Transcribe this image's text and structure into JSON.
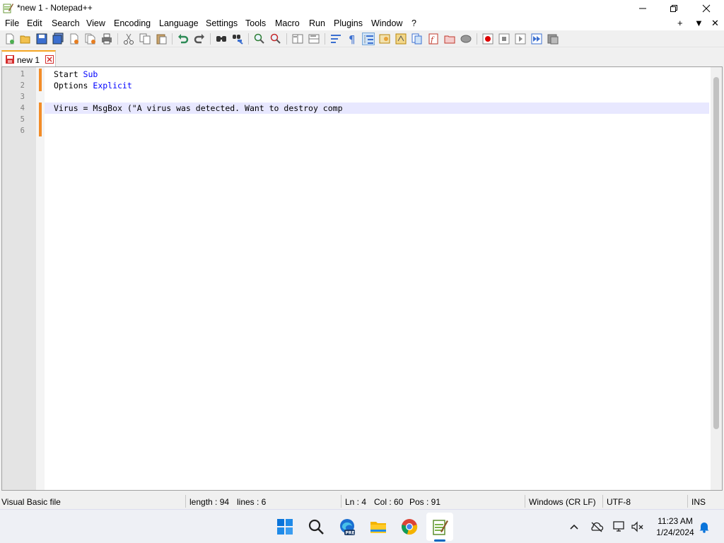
{
  "window": {
    "title": "*new 1 - Notepad++",
    "controls": {
      "minimize": "minimize",
      "maximize": "restore",
      "close": "close"
    }
  },
  "menu": {
    "items": [
      "File",
      "Edit",
      "Search",
      "View",
      "Encoding",
      "Language",
      "Settings",
      "Tools",
      "Macro",
      "Run",
      "Plugins",
      "Window",
      "?"
    ],
    "right": [
      "+",
      "▼",
      "✕"
    ]
  },
  "tab": {
    "label": "new 1",
    "modified": true
  },
  "editor": {
    "line_numbers": [
      "1",
      "2",
      "3",
      "4",
      "5",
      "6"
    ],
    "current_line": 4,
    "lines": [
      {
        "parts": [
          {
            "text": "Start ",
            "kw": false
          },
          {
            "text": "Sub",
            "kw": true
          }
        ]
      },
      {
        "parts": [
          {
            "text": "Options ",
            "kw": false
          },
          {
            "text": "Explicit",
            "kw": true
          }
        ]
      },
      {
        "parts": []
      },
      {
        "parts": [
          {
            "text": "Virus = MsgBox (\"A virus was detected. Want to destroy comp",
            "kw": false
          }
        ]
      },
      {
        "parts": []
      },
      {
        "parts": []
      }
    ]
  },
  "status": {
    "file_type": "Visual Basic file",
    "length": "length : 94",
    "lines": "lines : 6",
    "ln": "Ln : 4",
    "col": "Col : 60",
    "pos": "Pos : 91",
    "eol": "Windows (CR LF)",
    "encoding": "UTF-8",
    "mode": "INS"
  },
  "taskbar": {
    "apps": [
      "start-icon",
      "search-icon",
      "edge-beta-icon",
      "file-explorer-icon",
      "chrome-icon",
      "notepadpp-icon"
    ],
    "active_app": "notepadpp-icon",
    "time": "11:23 AM",
    "date": "1/24/2024"
  },
  "colors": {
    "keyword": "#0000ff",
    "current_line_bg": "#e8e8ff",
    "change_mark": "#f28c28",
    "tab_accent": "#f5a623"
  }
}
